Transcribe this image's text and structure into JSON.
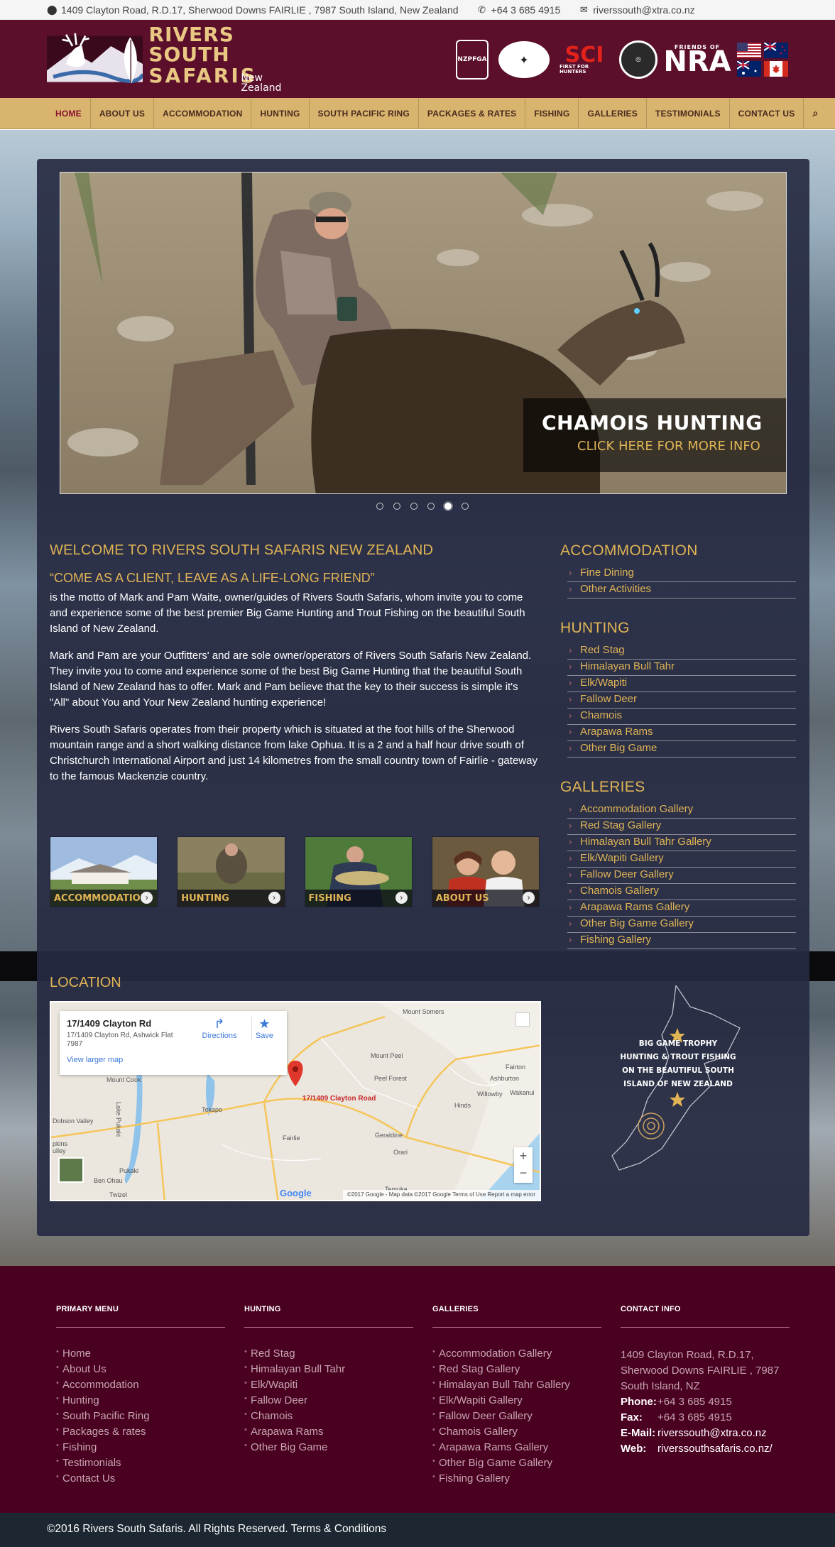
{
  "topbar": {
    "address": "1409 Clayton Road, R.D.17, Sherwood Downs FAIRLIE , 7987 South Island, New Zealand",
    "phone": "+64 3 685 4915",
    "email": "riverssouth@xtra.co.nz"
  },
  "logo": {
    "line1": "RIVERS SOUTH",
    "line2": "SAFARIS",
    "line3": "New Zealand"
  },
  "badges": {
    "nzpfga": "NZPFGA",
    "sci": "SCI",
    "sci_sub": "FIRST FOR HUNTERS",
    "nra": "NRA",
    "nra_sub": "FRIENDS OF"
  },
  "nav": [
    "HOME",
    "ABOUT US",
    "ACCOMMODATION",
    "HUNTING",
    "SOUTH PACIFIC RING",
    "PACKAGES & RATES",
    "FISHING",
    "GALLERIES",
    "TESTIMONIALS",
    "CONTACT US"
  ],
  "slider": {
    "caption_title": "CHAMOIS HUNTING",
    "caption_sub": "CLICK HERE FOR MORE INFO",
    "dots": 6,
    "active_dot": 5
  },
  "welcome": {
    "title": "WELCOME TO RIVERS SOUTH SAFARIS NEW ZEALAND",
    "motto": "“COME AS A CLIENT, LEAVE AS A LIFE-LONG FRIEND”",
    "p1": "is the motto of Mark and Pam Waite, owner/guides of Rivers South Safaris, whom invite you to come and experience some of the best premier Big Game Hunting and Trout Fishing on the beautiful South Island of New Zealand.",
    "p2": "Mark and Pam are your Outfitters' and are sole owner/operators of Rivers South Safaris New Zealand. They invite you to come and experience some of the best Big Game Hunting that the beautiful South Island of New Zealand has to offer. Mark and Pam believe that the key to their success is simple it's \"All\" about You and Your New Zealand hunting experience!",
    "p3": "Rivers South Safaris operates from their property which is situated at the foot hills of the Sherwood mountain range and a short walking distance from lake Ophua. It is a 2 and a half hour drive south of Christchurch International Airport and just 14 kilometres from the small country town of Fairlie - gateway to the famous Mackenzie country."
  },
  "tiles": [
    "ACCOMMODATION",
    "HUNTING",
    "FISHING",
    "ABOUT US"
  ],
  "sidebar": {
    "accommodation": {
      "title": "ACCOMMODATION",
      "items": [
        "Fine Dining",
        "Other Activities"
      ]
    },
    "hunting": {
      "title": "HUNTING",
      "items": [
        "Red Stag",
        "Himalayan Bull Tahr",
        "Elk/Wapiti",
        "Fallow Deer",
        "Chamois",
        "Arapawa Rams",
        "Other Big Game"
      ]
    },
    "galleries": {
      "title": "GALLERIES",
      "items": [
        "Accommodation Gallery",
        "Red Stag Gallery",
        "Himalayan Bull Tahr Gallery",
        "Elk/Wapiti Gallery",
        "Fallow Deer Gallery",
        "Chamois Gallery",
        "Arapawa Rams Gallery",
        "Other Big Game Gallery",
        "Fishing Gallery"
      ]
    }
  },
  "location": {
    "title": "LOCATION",
    "card_name": "17/1409 Clayton Rd",
    "card_address": "17/1409 Clayton Rd, Ashwick Flat 7987",
    "card_link": "View larger map",
    "directions": "Directions",
    "save": "Save",
    "pin_label": "17/1409 Clayton Road",
    "places": [
      "Mount Somers",
      "Mount Peel",
      "Peel Forest",
      "Fairton",
      "Ashburton",
      "Willowby",
      "Wakanui",
      "Hinds",
      "Mount Cook",
      "Tekapo",
      "Lake Pukaki",
      "Dobson Valley",
      "pkins ulley",
      "Pukaki",
      "Ben Ohau",
      "Twizel",
      "Fairlie",
      "Geraldine",
      "Orari",
      "Temuka"
    ],
    "map_footer": "©2017 Google - Map data ©2017 Google    Terms of Use    Report a map error",
    "google": "Google",
    "nz_text": "BIG GAME TROPHY HUNTING & TROUT FISHING ON THE BEAUTIFUL SOUTH ISLAND OF NEW ZEALAND"
  },
  "footer": {
    "primary": {
      "title": "PRIMARY MENU",
      "items": [
        "Home",
        "About Us",
        "Accommodation",
        "Hunting",
        "South Pacific Ring",
        "Packages & rates",
        "Fishing",
        "Testimonials",
        "Contact Us"
      ]
    },
    "hunting": {
      "title": "HUNTING",
      "items": [
        "Red Stag",
        "Himalayan Bull Tahr",
        "Elk/Wapiti",
        "Fallow Deer",
        "Chamois",
        "Arapawa Rams",
        "Other Big Game"
      ]
    },
    "galleries": {
      "title": "GALLERIES",
      "items": [
        "Accommodation Gallery",
        "Red Stag Gallery",
        "Himalayan Bull Tahr Gallery",
        "Elk/Wapiti Gallery",
        "Fallow Deer Gallery",
        "Chamois Gallery",
        "Arapawa Rams Gallery",
        "Other Big Game Gallery",
        "Fishing Gallery"
      ]
    },
    "contact": {
      "title": "CONTACT INFO",
      "address": "1409 Clayton Road, R.D.17, Sherwood Downs FAIRLIE , 7987 South Island, NZ",
      "phone_label": "Phone:",
      "phone": "+64 3 685 4915",
      "fax_label": "Fax:",
      "fax": "+64 3 685 4915",
      "email_label": "E-Mail:",
      "email": "riverssouth@xtra.co.nz",
      "web_label": "Web:",
      "web": "riverssouthsafaris.co.nz/"
    }
  },
  "copyright": "©2016 Rivers South Safaris. All Rights Reserved. Terms & Conditions",
  "colors": {
    "brand": "#5c0f2b",
    "nav": "#d9b46e",
    "accent": "#e0b455",
    "footer": "#4a0020"
  }
}
